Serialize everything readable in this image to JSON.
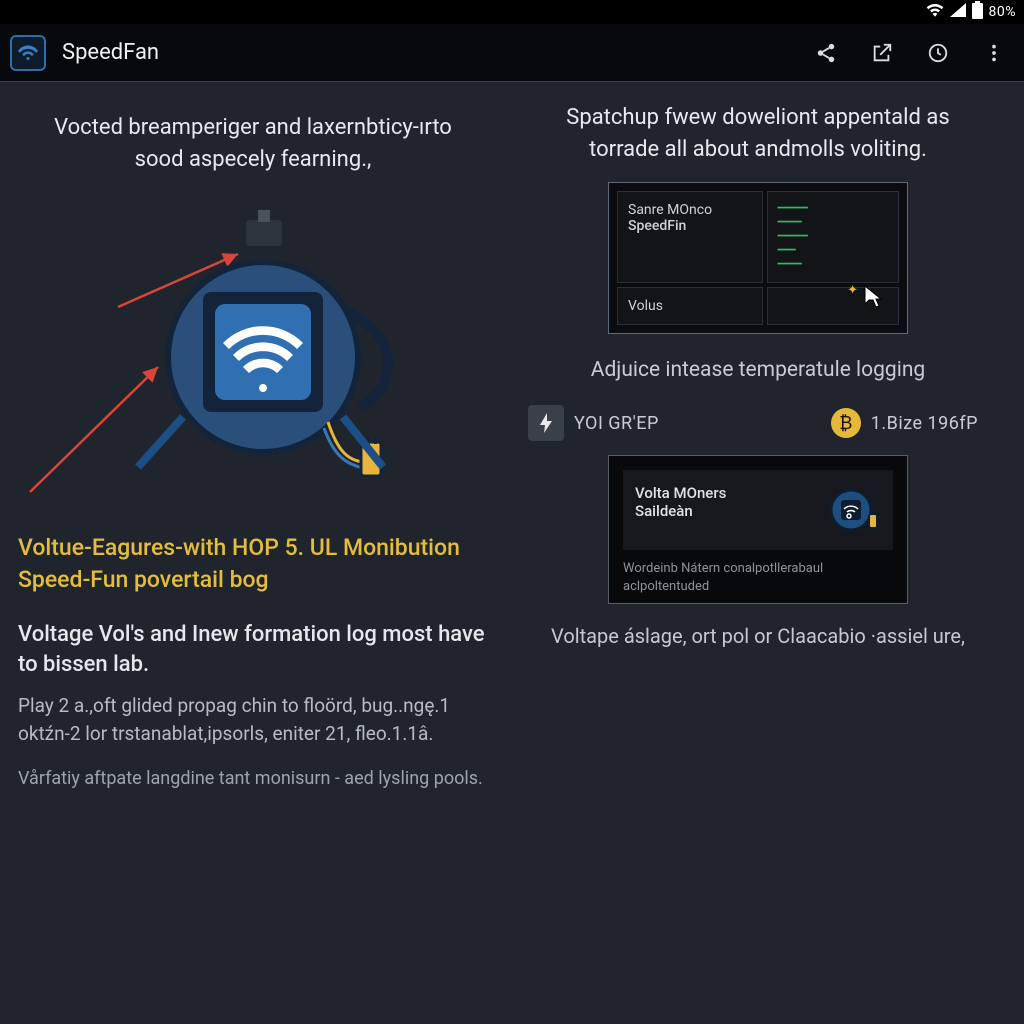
{
  "status": {
    "battery_pct": "80%"
  },
  "app": {
    "title": "SpeedFan"
  },
  "left": {
    "intro": "Vocted breamperiger and laxernbticy-ırto sood aspecely fearning.,",
    "feature_title_a": "Voltue-Eagures-with ",
    "feature_title_hl": "HOP 5. UL",
    "feature_title_b": " Monibution Speed-Fun povertail bog",
    "sec_h": "Voltage Vol's and Inew formation log most have to bissen lab.",
    "p1": "Play 2 a.,oft glided propag chin to floörd, bug..ngę.1 oktźn-2 lor trstanablat,ipsorls, eniter 21, fleo.1.1â.",
    "p2": "Vårfatiy aftpate langdine tant monisurn - aed lysling pools."
  },
  "right": {
    "intro": "Spatchup fwew doweliont appentald as torrade all about andmolls voliting.",
    "preview": {
      "cell_a1": "Sanre MOnco",
      "cell_a2": "SpeedFin",
      "cell_b": "Volus"
    },
    "caption": "Adjuice intease temperatule logging",
    "stat_a_label": "YOI GR'EP",
    "stat_b_label": "1.Bize 196fP",
    "card2": {
      "t1": "Volta MOners",
      "t2": "Saildeàn",
      "desc": "Wordeinb Nátern conalpotllerabaul aclpoltentuded"
    },
    "subcap": "Voltape áslage, ort pol or Claacabio ·assiel ure,"
  }
}
